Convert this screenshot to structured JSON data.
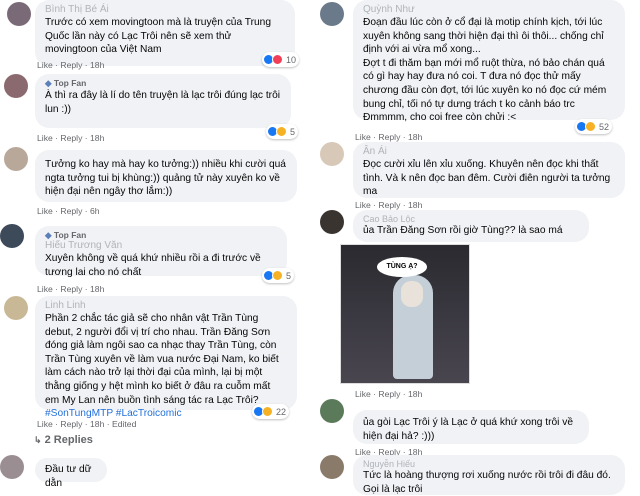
{
  "left": [
    {
      "name": "Bình Thị Bé Ái",
      "top_fan": "",
      "text": "Trước có xem movingtoon mà là truyện của Trung Quốc lần này có Lạc Trôi nên sẽ xem thử movingtoon của Việt Nam",
      "actions": "Like · Reply · 18h",
      "reactions": [
        "like",
        "heart"
      ],
      "count": "10",
      "avatar": "#7a6a78"
    },
    {
      "name": "Top Fan",
      "top_fan": "",
      "text": "À thì ra đây là lí do tên truyện là lạc trôi đúng lạc trôi lun :))",
      "actions": "Like · Reply · 18h",
      "reactions": [
        "like",
        "haha"
      ],
      "count": "5",
      "avatar": "#8a6a6f"
    },
    {
      "name": "",
      "top_fan": "",
      "text": "Tưởng ko hay mà hay ko tưởng:)) nhiều khi cười quá ngta tưởng tui bị khùng:)) quảng tử này xuyên ko về hiện đại nên ngây thơ lắm:))",
      "actions": "Like · Reply · 6h",
      "reactions": [],
      "count": "",
      "avatar": "#b8a89a"
    },
    {
      "name": "Hiếu Trương Văn",
      "top_fan": "Top Fan",
      "text": "Xuyên không về quá khứ nhiều rồi a đi trước về tương lai cho nó chất",
      "actions": "Like · Reply · 18h",
      "reactions": [
        "like",
        "haha"
      ],
      "count": "5",
      "avatar": "#3d4a5a"
    },
    {
      "name": "Linh Linh",
      "top_fan": "",
      "text": "Phần 2 chắc tác giả sẽ cho nhân vật Trần Tùng debut, 2 người đổi vị trí cho nhau. Trần Đăng Sơn đóng giả làm ngôi sao ca nhạc thay Trần Tùng, còn Trần Tùng xuyên về làm vua nước Đại Nam, ko biết làm cách nào trở lại thời đại của mình, lại bị một thằng giống y hệt mình ko biết ở đâu ra cuỗm mất em My Lan nên buồn tình sáng tác ra Lạc Trôi?",
      "hashtags": "#SonTungMTP #LacTroicomic",
      "actions": "Like · Reply · 18h · Edited",
      "reactions": [
        "like",
        "haha"
      ],
      "count": "22",
      "avatar": "#c9b896"
    },
    {
      "replies": "2 Replies"
    },
    {
      "name": "",
      "top_fan": "",
      "text": "Đầu tư dữ dằn",
      "actions": "",
      "reactions": [],
      "count": "",
      "avatar": "#9a8e92"
    }
  ],
  "right": [
    {
      "name": "Quỳnh Như",
      "top_fan": "",
      "text": "Đoạn đầu lúc còn ở cổ đại là motip chính kịch, tới lúc xuyên không sang thời hiện đại thì ôi thôi... chống chỉ định với ai vừa mổ xong...\nĐợt t đi thăm bạn mới mổ ruột thừa, nó bảo chán quá có gì hay hay đưa nó coi. T đưa nó đọc thử mấy chương đầu còn đợt, tới lúc xuyên ko nó đọc cứ mém bung chỉ, tối nó tự dưng trách t ko cảnh báo trc",
      "text2": "Đmmmm, cho coi free còn chửi :<",
      "actions": "Like · Reply · 18h",
      "reactions": [
        "like",
        "haha"
      ],
      "count": "52",
      "avatar": "#6a7a8a"
    },
    {
      "name": "Ân Ái",
      "top_fan": "",
      "text": "Đọc cười xỉu lên xỉu xuống. Khuyên nên đọc khi thất tình. Và k nên đọc ban đêm. Cười điên người ta tưởng ma",
      "actions": "Like · Reply · 18h",
      "reactions": [],
      "count": "",
      "avatar": "#d8c8b8"
    },
    {
      "name": "Cao Bảo Lộc",
      "top_fan": "",
      "text": "ủa Trần Đăng Sơn rồi giờ Tùng?? là sao má",
      "comic_bubble": "TÙNG Ạ?",
      "actions": "Like · Reply · 18h",
      "reactions": [],
      "count": "",
      "avatar": "#3a3430"
    },
    {
      "name": "",
      "top_fan": "",
      "text": "ủa gòi Lạc Trôi ý là Lạc ở quá khứ xong trôi về hiện đại hả? :)))",
      "actions": "Like · Reply · 18h",
      "reactions": [],
      "count": "",
      "avatar": "#5a7a5a"
    },
    {
      "name": "Nguyễn Hiếu",
      "top_fan": "",
      "text": "Tức là hoàng thượng rơi xuống nước rồi trôi đi đâu đó. Gọi là lạc trôi",
      "actions": "",
      "reactions": [],
      "count": "",
      "avatar": "#8a7a6a"
    }
  ],
  "colors": {
    "bubble": "#f0f2f5",
    "meta": "#65676b",
    "link": "#216fdb",
    "like": "#1877f2",
    "haha": "#f7b125"
  },
  "icons": {
    "top_fan": "diamond-icon"
  }
}
